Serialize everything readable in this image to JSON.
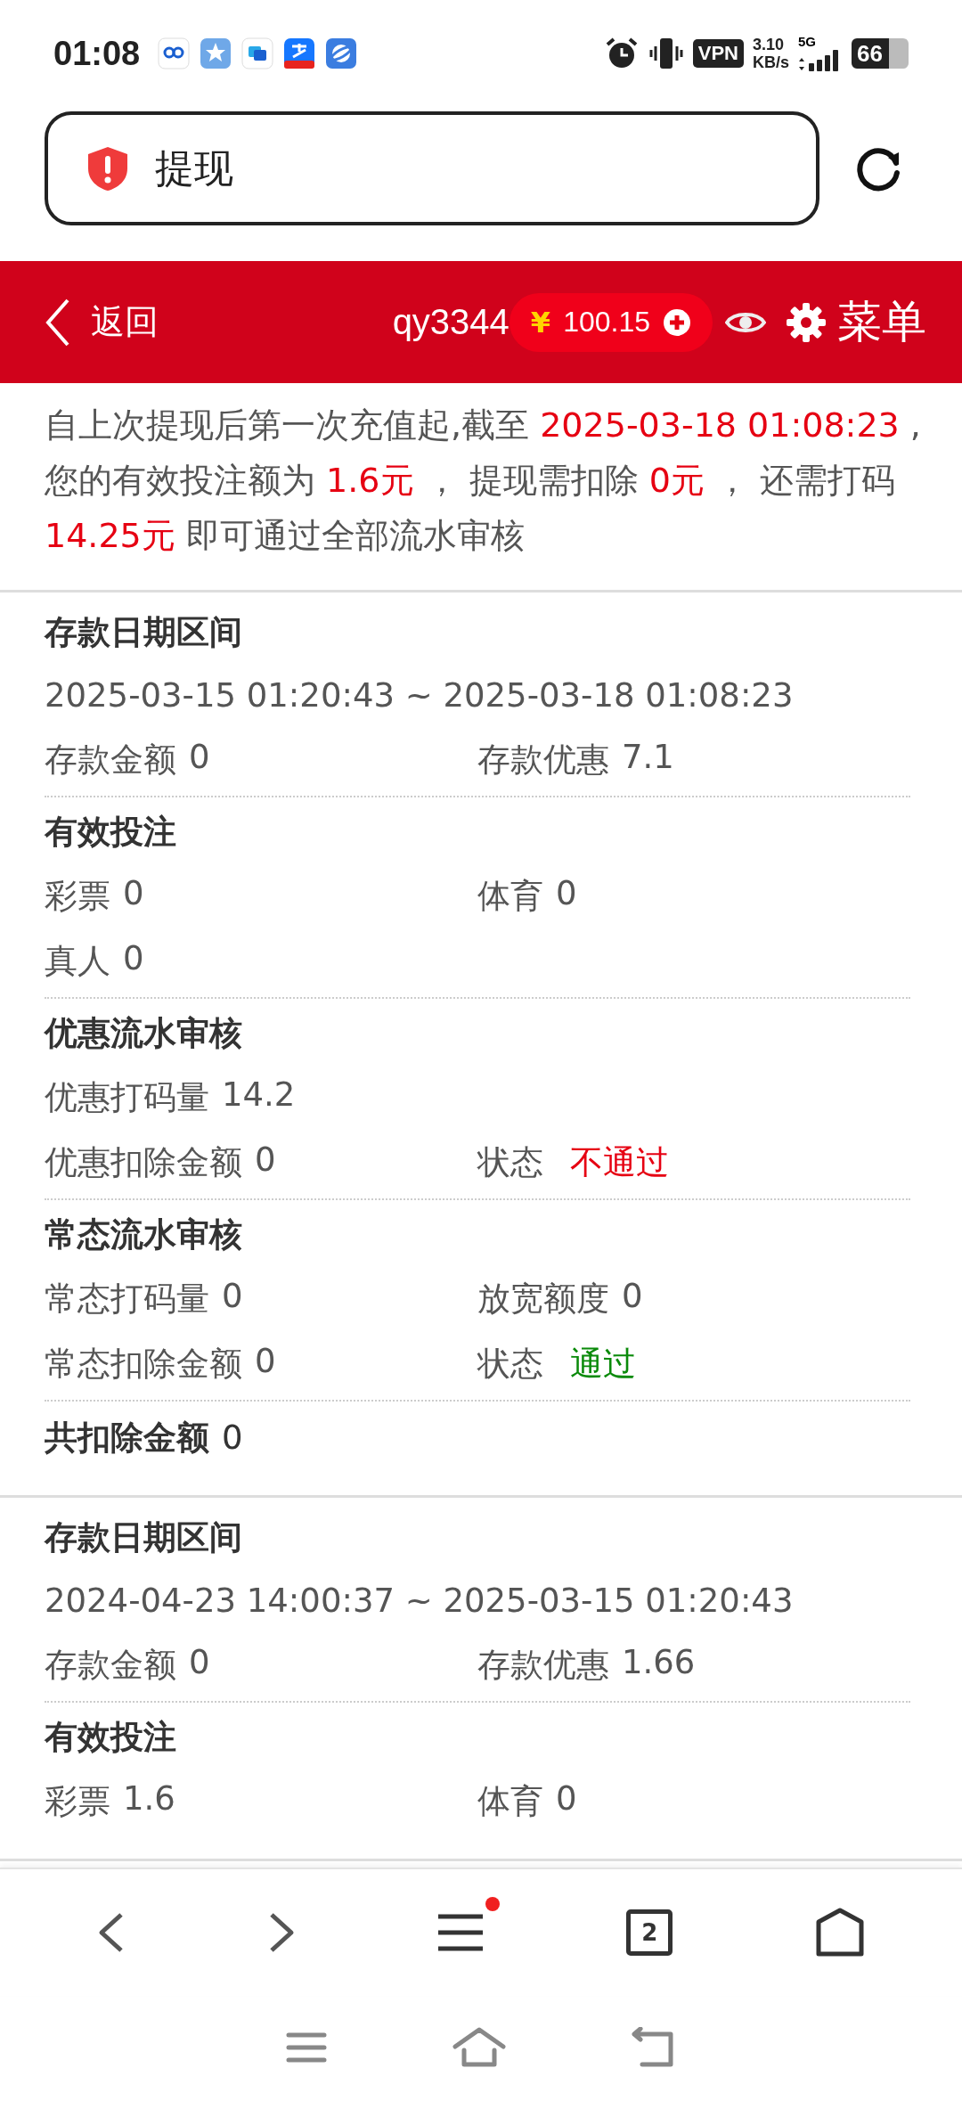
{
  "status_bar": {
    "time": "01:08",
    "vpn": "VPN",
    "speed_value": "3.10",
    "speed_unit": "KB/s",
    "network": "5G",
    "battery": "66"
  },
  "address_bar": {
    "title": "提现"
  },
  "header": {
    "back": "返回",
    "username": "qy3344",
    "currency": "¥",
    "balance": "100.15",
    "menu": "菜单"
  },
  "notice": [
    {
      "text": "自上次提现后第一次充值起,截至 ",
      "highlight": false
    },
    {
      "text": " 2025-03-18 01:08:23 ",
      "highlight": true
    },
    {
      "text": " ,您的有效投注额为 ",
      "highlight": false
    },
    {
      "text": " 1.6元 ",
      "highlight": true
    },
    {
      "text": " ，  提现需扣除 ",
      "highlight": false
    },
    {
      "text": " 0元 ",
      "highlight": true
    },
    {
      "text": " ，  还需打码 ",
      "highlight": false
    },
    {
      "text": " 14.25元 ",
      "highlight": true
    },
    {
      "text": "  即可通过全部流水审核",
      "highlight": false
    }
  ],
  "records": [
    {
      "range_title": "存款日期区间",
      "range": "2025-03-15 01:20:43 ~ 2025-03-18 01:08:23",
      "groups": [
        {
          "rows": [
            [
              {
                "label": "存款金额",
                "value": "0"
              },
              {
                "label": "存款优惠",
                "value": "7.1"
              }
            ]
          ]
        },
        {
          "title": "有效投注",
          "rows": [
            [
              {
                "label": "彩票",
                "value": "0"
              },
              {
                "label": "体育",
                "value": "0"
              }
            ],
            [
              {
                "label": "真人",
                "value": "0"
              }
            ]
          ]
        },
        {
          "title": "优惠流水审核",
          "rows": [
            [
              {
                "label": "优惠打码量",
                "value": "14.2"
              }
            ],
            [
              {
                "label": "优惠扣除金额",
                "value": "0"
              },
              {
                "label": "状态",
                "value": "不通过",
                "passed": false
              }
            ]
          ]
        },
        {
          "title": "常态流水审核",
          "rows": [
            [
              {
                "label": "常态打码量",
                "value": "0"
              },
              {
                "label": "放宽额度",
                "value": "0"
              }
            ],
            [
              {
                "label": "常态扣除金额",
                "value": "0"
              },
              {
                "label": "状态",
                "value": "通过",
                "passed": true
              }
            ]
          ]
        }
      ],
      "total": {
        "label": "共扣除金额",
        "value": "0"
      }
    },
    {
      "range_title": "存款日期区间",
      "range": "2024-04-23 14:00:37 ~ 2025-03-15 01:20:43",
      "groups": [
        {
          "rows": [
            [
              {
                "label": "存款金额",
                "value": "0"
              },
              {
                "label": "存款优惠",
                "value": "1.66"
              }
            ]
          ]
        },
        {
          "title": "有效投注",
          "rows": [
            [
              {
                "label": "彩票",
                "value": "1.6"
              },
              {
                "label": "体育",
                "value": "0"
              }
            ]
          ]
        }
      ]
    }
  ],
  "browser_toolbar": {
    "menu_badge": true,
    "tab_count": "2"
  }
}
